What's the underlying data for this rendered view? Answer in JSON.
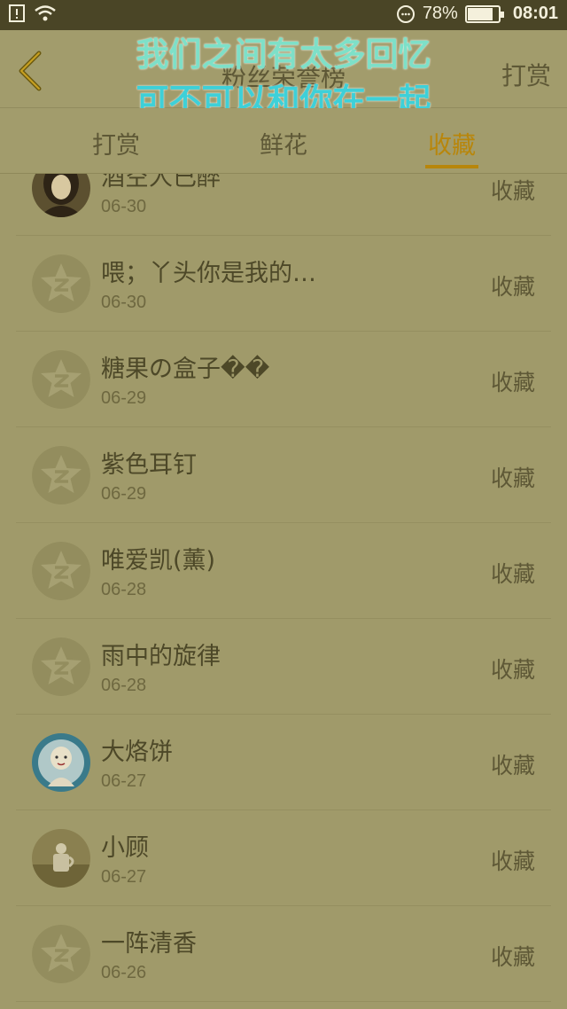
{
  "status_bar": {
    "battery": "78%",
    "time": "08:01"
  },
  "header": {
    "title": "粉丝荣誉榜",
    "right_label": "打赏"
  },
  "overlay_text": {
    "line1": "我们之间有太多回忆",
    "line2": "可不可以和你在一起"
  },
  "tabs": [
    {
      "label": "打赏",
      "active": false
    },
    {
      "label": "鲜花",
      "active": false
    },
    {
      "label": "收藏",
      "active": true
    }
  ],
  "list": [
    {
      "name": "酒空人已醉",
      "date": "06-30",
      "action": "收藏",
      "avatar": "photo-girl"
    },
    {
      "name": "喂；丫头你是我的…",
      "date": "06-30",
      "action": "收藏",
      "avatar": "default"
    },
    {
      "name": "糖果の盒子��",
      "date": "06-29",
      "action": "收藏",
      "avatar": "default"
    },
    {
      "name": "紫色耳钉",
      "date": "06-29",
      "action": "收藏",
      "avatar": "default"
    },
    {
      "name": "唯爱凯(薰)",
      "date": "06-28",
      "action": "收藏",
      "avatar": "default"
    },
    {
      "name": "雨中的旋律",
      "date": "06-28",
      "action": "收藏",
      "avatar": "default"
    },
    {
      "name": "大烙饼",
      "date": "06-27",
      "action": "收藏",
      "avatar": "photo-cartoon"
    },
    {
      "name": "小顾",
      "date": "06-27",
      "action": "收藏",
      "avatar": "photo-cup"
    },
    {
      "name": "一阵清香",
      "date": "06-26",
      "action": "收藏",
      "avatar": "default"
    }
  ]
}
